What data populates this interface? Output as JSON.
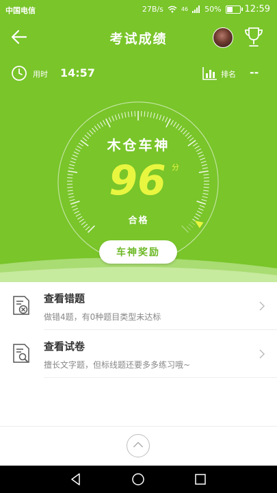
{
  "status_bar": {
    "carrier": "中国电信",
    "speed": "27B/s",
    "signal": "46",
    "battery": "50%",
    "battery_level": 0.5,
    "time": "12:59"
  },
  "header": {
    "title": "考试成绩"
  },
  "info": {
    "time_label": "用时",
    "time_value": "14:57",
    "rank_label": "排名",
    "rank_value": "--"
  },
  "result": {
    "title": "木仓车神",
    "score": "96",
    "unit": "分",
    "status": "合格",
    "award_button": "车神奖励"
  },
  "menu": [
    {
      "title": "查看错题",
      "subtitle": "做错4题，有0种题目类型未达标",
      "icon": "wrong-questions-icon"
    },
    {
      "title": "查看试卷",
      "subtitle": "擅长文字题，但标线题还要多多练习哦~",
      "icon": "view-paper-icon"
    }
  ],
  "colors": {
    "primary_green": "#79c52a",
    "score_yellow": "#e8f640"
  }
}
